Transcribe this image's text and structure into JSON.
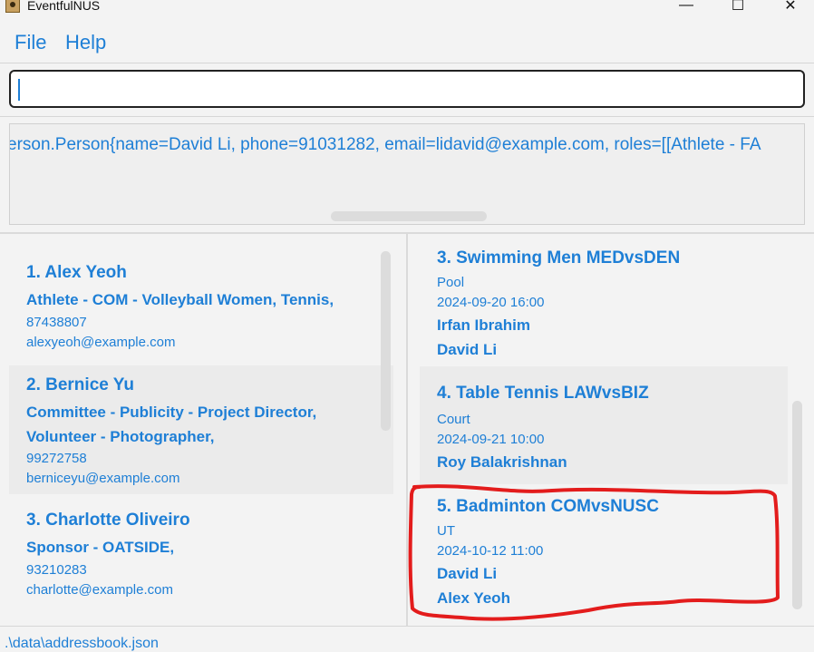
{
  "window": {
    "title": "EventfulNUS",
    "minimize": "—",
    "maximize": "☐",
    "close": "✕"
  },
  "menu": {
    "file": "File",
    "help": "Help"
  },
  "command": {
    "value": ""
  },
  "result": {
    "text": "erson.Person{name=David Li, phone=91031282, email=lidavid@example.com, roles=[[Athlete - FA"
  },
  "persons": [
    {
      "index_name": "1. Alex Yeoh",
      "roles": [
        "Athlete - COM - Volleyball Women, Tennis,"
      ],
      "phone": "87438807",
      "email": "alexyeoh@example.com"
    },
    {
      "index_name": "2. Bernice Yu",
      "roles": [
        "Committee - Publicity - Project Director,",
        "Volunteer - Photographer,"
      ],
      "phone": "99272758",
      "email": "berniceyu@example.com"
    },
    {
      "index_name": "3. Charlotte Oliveiro",
      "roles": [
        "Sponsor - OATSIDE,"
      ],
      "phone": "93210283",
      "email": "charlotte@example.com"
    }
  ],
  "events": [
    {
      "index_name": "3. Swimming Men MEDvsDEN",
      "venue": "Pool",
      "datetime": "2024-09-20 16:00",
      "participants": [
        "Irfan Ibrahim",
        "David Li"
      ]
    },
    {
      "index_name": "4. Table Tennis LAWvsBIZ",
      "venue": "Court",
      "datetime": "2024-09-21 10:00",
      "participants": [
        "Roy Balakrishnan"
      ]
    },
    {
      "index_name": "5. Badminton COMvsNUSC",
      "venue": "UT",
      "datetime": "2024-10-12 11:00",
      "participants": [
        "David Li",
        "Alex Yeoh"
      ]
    }
  ],
  "status": {
    "path": ".\\data\\addressbook.json"
  },
  "colors": {
    "accent": "#1e7fd6",
    "highlight": "#e31c1c",
    "card_alt": "#ebebeb"
  }
}
